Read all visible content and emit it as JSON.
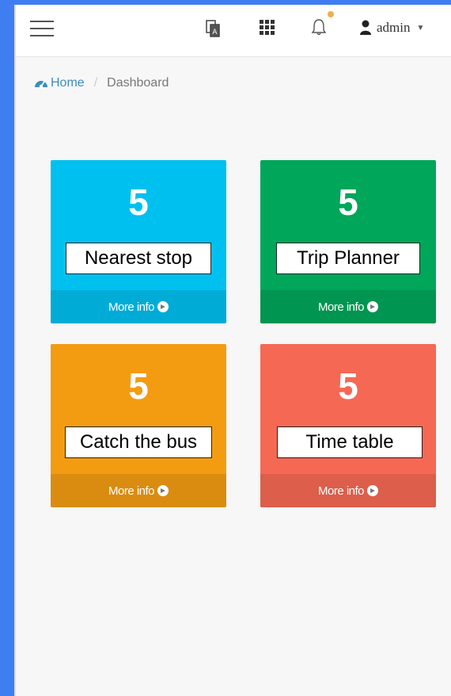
{
  "header": {
    "icons": [
      "hamburger-menu-icon",
      "translate-icon",
      "apps-grid-icon",
      "bell-icon",
      "user-icon"
    ],
    "user_name": "admin",
    "accent": "#3c8dbc"
  },
  "breadcrumb": {
    "home": "Home",
    "current": "Dashboard"
  },
  "boxes": [
    {
      "number": "5",
      "label": "Nearest stop",
      "footer": "More info",
      "color": "#00c0ef"
    },
    {
      "number": "5",
      "label": "Trip Planner",
      "footer": "More info",
      "color": "#00a65a"
    },
    {
      "number": "5",
      "label": "Catch the bus",
      "footer": "More info",
      "color": "#f39c12"
    },
    {
      "number": "5",
      "label": "Time table",
      "footer": "More info",
      "color": "#f56954"
    }
  ]
}
